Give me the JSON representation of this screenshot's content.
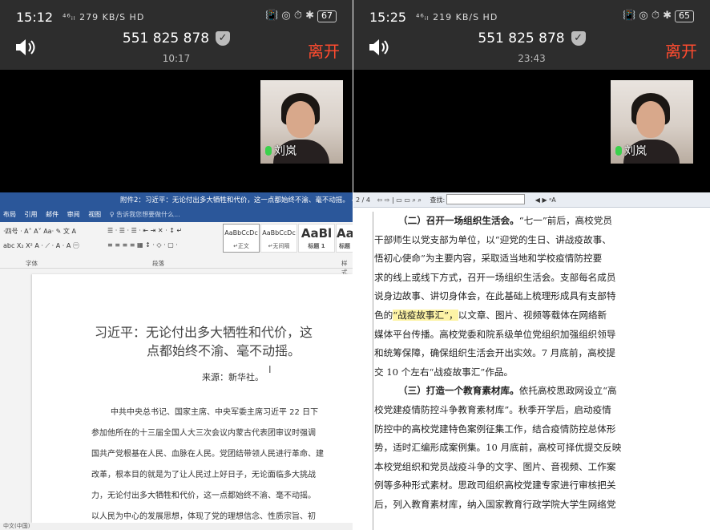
{
  "left": {
    "status": {
      "time": "15:12",
      "icons": "⁴⁶ᵢₗ 279 KB/S HD",
      "right": "📳 ◎ ⏱ ✱",
      "battery": "67"
    },
    "call": {
      "number": "551 825 878",
      "shield": "✓",
      "duration": "10:17",
      "leave": "离开"
    },
    "participant": "刘岚",
    "word": {
      "title": "附件2：习近平：无论付出多大牺牲和代价，这一点都始终不渝、毫不动摇。 - Word",
      "tabs": [
        "布局",
        "引用",
        "邮件",
        "审阅",
        "视图"
      ],
      "tell_me": "♀ 告诉我您想要做什么...",
      "font_row1": "·四号 · A˄ A˅  Aa·  ✎ 文 A",
      "font_row2": "abc X₂ X²  A · ⟋ · A · A ㊀",
      "para_row1": "☰ · ☰ · ☰ ·  ⇤ ⇥  ✕ ·  ↕ ↵",
      "para_row2": "≡ ≡ ≡ ≡ ▦  ↕ ·  ◇ · ▢ ·",
      "styles": [
        {
          "preview": "AaBbCcDc",
          "name": "↵正文"
        },
        {
          "preview": "AaBbCcDc",
          "name": "↵无间隔"
        },
        {
          "preview": "AaBl",
          "name": "标题 1"
        },
        {
          "preview": "AaB",
          "name": "标题"
        }
      ],
      "groups": {
        "font": "字体",
        "paragraph": "段落",
        "styles": "样式"
      },
      "doc_title_line1": "习近平：无论付出多大牺牲和代价，这",
      "doc_title_line2": "点都始终不渝、毫不动摇。",
      "source": "来源：新华社。",
      "body_lines": [
        "中共中央总书记、国家主席、中央军委主席习近平 22 日下",
        "参加他所在的十三届全国人大三次会议内蒙古代表团审议时强调",
        "国共产党根基在人民、血脉在人民。党团结带领人民进行革命、建",
        "改革，根本目的就是为了让人民过上好日子，无论面临多大挑战",
        "力，无论付出多大牺牲和代价，这一点都始终不渝、毫不动摇。",
        "以人民为中心的发展思想，体现了党的理想信念、性质宗旨、初"
      ],
      "status_text": "中文(中国)"
    }
  },
  "right": {
    "status": {
      "time": "15:25",
      "icons": "⁴⁶ᵢₗ 219 KB/S HD",
      "right": "📳 ◎ ⏱ ✱",
      "battery": "65"
    },
    "call": {
      "number": "551 825 878",
      "shield": "✓",
      "duration": "23:43",
      "leave": "离开"
    },
    "participant": "刘岚",
    "pdf": {
      "page": "2 / 4",
      "tools": "⇦ ⇨ | ▭ ▭ ⌕ ⌕",
      "find_label": "查找:",
      "nav": "◀ ▶ ᵃA",
      "lines": [
        {
          "ind": true,
          "bold": "（二）召开一场组织生活会。",
          "text": "“七一”前后，高校党员"
        },
        {
          "text": "干部师生以党支部为单位，以“迎党的生日、讲战疫故事、"
        },
        {
          "text": "悟初心使命”为主要内容，采取适当地和学校疫情防控要"
        },
        {
          "text": "求的线上或线下方式，召开一场组织生活会。支部每名成员"
        },
        {
          "text": "说身边故事、讲切身体会，在此基础上梳理形成具有支部特"
        },
        {
          "pre": "色的",
          "hl": "“战疫故事汇”，",
          "text": "以文章、图片、视频等载体在网络新"
        },
        {
          "text": "媒体平台传播。高校党委和院系级单位党组织加强组织领导"
        },
        {
          "text": "和统筹保障，确保组织生活会开出实效。7 月底前，高校提"
        },
        {
          "text": "交 10 个左右“战疫故事汇”作品。"
        },
        {
          "ind": true,
          "bold": "（三）打造一个教育素材库。",
          "text": "依托高校思政网设立“高"
        },
        {
          "text": "校党建疫情防控斗争教育素材库”。秋季开学后，启动疫情"
        },
        {
          "text": "防控中的高校党建特色案例征集工作，结合疫情防控总体形"
        },
        {
          "text": "势，适时汇编形成案例集。10 月底前，高校可择优提交反映"
        },
        {
          "text": "本校党组织和党员战疫斗争的文字、图片、音视频、工作案"
        },
        {
          "text": "例等多种形式素材。思政司组织高校党建专家进行审核把关"
        },
        {
          "text": "后，列入教育素材库，纳入国家教育行政学院大学生网络党"
        }
      ]
    }
  }
}
